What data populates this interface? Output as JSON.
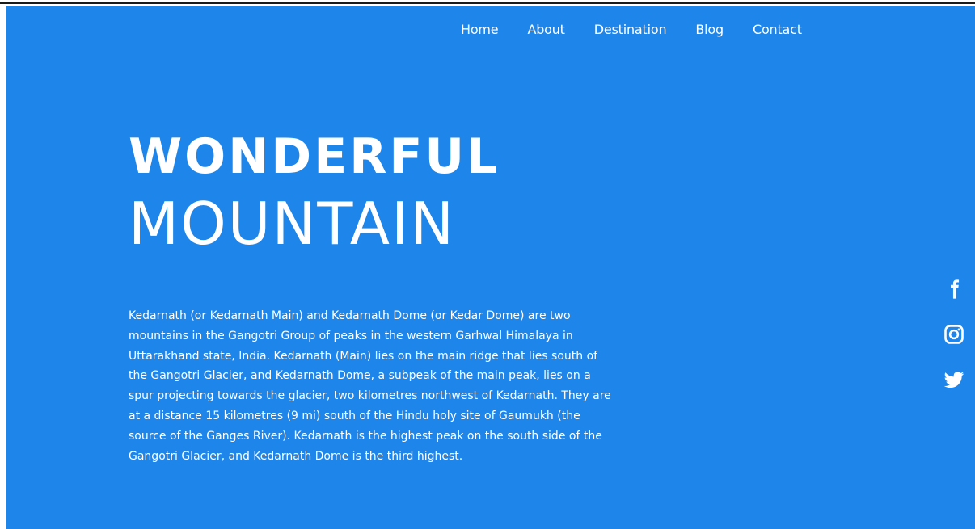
{
  "nav": {
    "items": [
      "Home",
      "About",
      "Destination",
      "Blog",
      "Contact"
    ]
  },
  "hero": {
    "title_bold": "WONDERFUL",
    "title_light": "MOUNTAIN",
    "description": "Kedarnath (or Kedarnath Main) and Kedarnath Dome (or Kedar Dome) are two mountains in the Gangotri Group of peaks in the western Garhwal Himalaya in Uttarakhand state, India. Kedarnath (Main) lies on the main ridge that lies south of the Gangotri Glacier, and Kedarnath Dome, a subpeak of the main peak, lies on a spur projecting towards the glacier, two kilometres northwest of Kedarnath. They are at a distance 15 kilometres (9 mi) south of the Hindu holy site of Gaumukh (the source of the Ganges River). Kedarnath is the highest peak on the south side of the Gangotri Glacier, and Kedarnath Dome is the third highest."
  },
  "social": {
    "icons": [
      "facebook-icon",
      "instagram-icon",
      "twitter-icon"
    ]
  },
  "colors": {
    "background": "#1e85ea",
    "text": "#ffffff"
  }
}
